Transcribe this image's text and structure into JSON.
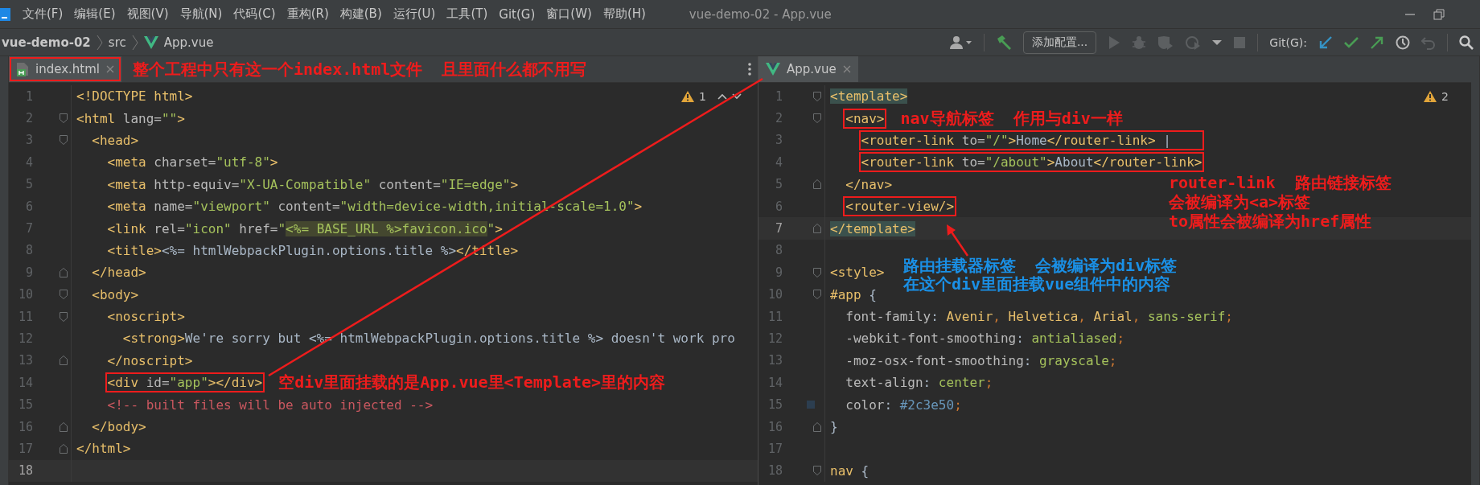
{
  "title_bar": {
    "menus": [
      "文件(F)",
      "编辑(E)",
      "视图(V)",
      "导航(N)",
      "代码(C)",
      "重构(R)",
      "构建(B)",
      "运行(U)",
      "工具(T)",
      "Git(G)",
      "窗口(W)",
      "帮助(H)"
    ],
    "title": "vue-demo-02 - App.vue"
  },
  "nav_bar": {
    "breadcrumbs": [
      {
        "text": "vue-demo-02",
        "kind": "project"
      },
      {
        "text": "src",
        "kind": "folder"
      },
      {
        "text": "App.vue",
        "kind": "vue"
      }
    ],
    "run_config": "添加配置...",
    "git_label": "Git(G):"
  },
  "panes": [
    {
      "tabs": [
        {
          "label": "index.html",
          "kind": "html",
          "selected": true,
          "boxed": true
        }
      ],
      "tab_note": {
        "text": "整个工程中只有这一个index.html文件  且里面什么都不用写",
        "color": "#ee1c1c"
      },
      "more_menu": true,
      "problems": "1",
      "nav_arrows": true,
      "lines": [
        {
          "n": "1",
          "current": false,
          "fold_start": false,
          "fold_end": false,
          "tokens": [
            {
              "kind": "tag",
              "text": "<!DOCTYPE html>"
            }
          ]
        },
        {
          "n": "2",
          "current": false,
          "fold_start": true,
          "fold_end": false,
          "tokens": [
            {
              "kind": "tag",
              "text": "<html"
            },
            {
              "kind": "attr",
              "text": " lang="
            },
            {
              "kind": "str",
              "text": "\"\""
            },
            {
              "kind": "tag",
              "text": ">"
            }
          ]
        },
        {
          "n": "3",
          "current": false,
          "fold_start": true,
          "fold_end": false,
          "tokens": [
            {
              "kind": "tag",
              "text": "  <head>"
            }
          ]
        },
        {
          "n": "4",
          "current": false,
          "fold_start": false,
          "fold_end": false,
          "tokens": [
            {
              "kind": "tag",
              "text": "    <meta"
            },
            {
              "kind": "attr",
              "text": " charset="
            },
            {
              "kind": "str",
              "text": "\"utf-8\""
            },
            {
              "kind": "tag",
              "text": ">"
            }
          ]
        },
        {
          "n": "5",
          "current": false,
          "fold_start": false,
          "fold_end": false,
          "tokens": [
            {
              "kind": "tag",
              "text": "    <meta"
            },
            {
              "kind": "attr",
              "text": " http-equiv="
            },
            {
              "kind": "str",
              "text": "\"X-UA-Compatible\""
            },
            {
              "kind": "attr",
              "text": " content="
            },
            {
              "kind": "str",
              "text": "\"IE=edge\""
            },
            {
              "kind": "tag",
              "text": ">"
            }
          ]
        },
        {
          "n": "6",
          "current": false,
          "fold_start": false,
          "fold_end": false,
          "tokens": [
            {
              "kind": "tag",
              "text": "    <meta"
            },
            {
              "kind": "attr",
              "text": " name="
            },
            {
              "kind": "str",
              "text": "\"viewport\""
            },
            {
              "kind": "attr",
              "text": " content="
            },
            {
              "kind": "str",
              "text": "\"width=device-width,initial-scale=1.0\""
            },
            {
              "kind": "tag",
              "text": ">"
            }
          ]
        },
        {
          "n": "7",
          "current": false,
          "fold_start": false,
          "fold_end": false,
          "tokens": [
            {
              "kind": "tag",
              "text": "    <link"
            },
            {
              "kind": "attr",
              "text": " rel="
            },
            {
              "kind": "str",
              "text": "\"icon\""
            },
            {
              "kind": "attr",
              "text": " href="
            },
            {
              "kind": "str",
              "text": "\""
            },
            {
              "kind": "inj",
              "text": "<%= BASE_URL %>favicon.ico"
            },
            {
              "kind": "str",
              "text": "\""
            },
            {
              "kind": "tag",
              "text": ">"
            }
          ]
        },
        {
          "n": "8",
          "current": false,
          "fold_start": false,
          "fold_end": false,
          "tokens": [
            {
              "kind": "tag",
              "text": "    <title>"
            },
            {
              "kind": "text",
              "text": "<%= htmlWebpackPlugin.options.title %>"
            },
            {
              "kind": "tag",
              "text": "</title>"
            }
          ]
        },
        {
          "n": "9",
          "current": false,
          "fold_start": false,
          "fold_end": true,
          "tokens": [
            {
              "kind": "tag",
              "text": "  </head>"
            }
          ]
        },
        {
          "n": "10",
          "current": false,
          "fold_start": true,
          "fold_end": false,
          "tokens": [
            {
              "kind": "tag",
              "text": "  <body>"
            }
          ]
        },
        {
          "n": "11",
          "current": false,
          "fold_start": true,
          "fold_end": false,
          "tokens": [
            {
              "kind": "tag",
              "text": "    <noscript>"
            }
          ]
        },
        {
          "n": "12",
          "current": false,
          "fold_start": false,
          "fold_end": false,
          "tokens": [
            {
              "kind": "tag",
              "text": "      <strong>"
            },
            {
              "kind": "text",
              "text": "We're sorry but <%= htmlWebpackPlugin.options.title %> doesn't work pro"
            }
          ]
        },
        {
          "n": "13",
          "current": false,
          "fold_start": false,
          "fold_end": true,
          "tokens": [
            {
              "kind": "tag",
              "text": "    </noscript>"
            }
          ]
        },
        {
          "n": "14",
          "current": false,
          "fold_start": false,
          "fold_end": false,
          "tokens": [
            {
              "kind": "box",
              "tokens": [
                {
                  "kind": "tag",
                  "text": "    <div"
                },
                {
                  "kind": "attr",
                  "text": " id="
                },
                {
                  "kind": "str",
                  "text": "\"app\""
                },
                {
                  "kind": "tag",
                  "text": "></div>"
                }
              ]
            }
          ],
          "note": {
            "text": "空div里面挂载的是App.vue里<Template>里的内容",
            "color": "#ee1c1c"
          }
        },
        {
          "n": "15",
          "current": false,
          "fold_start": false,
          "fold_end": false,
          "tokens": [
            {
              "kind": "comment",
              "text": "    <!-- built files will be auto injected -->"
            }
          ]
        },
        {
          "n": "16",
          "current": false,
          "fold_start": false,
          "fold_end": true,
          "tokens": [
            {
              "kind": "tag",
              "text": "  </body>"
            }
          ]
        },
        {
          "n": "17",
          "current": false,
          "fold_start": false,
          "fold_end": true,
          "tokens": [
            {
              "kind": "tag",
              "text": "</html>"
            }
          ]
        },
        {
          "n": "18",
          "current": true,
          "fold_start": false,
          "fold_end": false
        }
      ]
    },
    {
      "tabs": [
        {
          "label": "App.vue",
          "kind": "vue",
          "selected": true,
          "boxed": false
        }
      ],
      "more_menu": false,
      "problems": "2",
      "nav_arrows": false,
      "lines": [
        {
          "n": "1",
          "current": false,
          "fold_start": true,
          "fold_end": false,
          "tokens": [
            {
              "kind": "match",
              "text": "<template>"
            }
          ]
        },
        {
          "n": "2",
          "current": false,
          "fold_start": true,
          "fold_end": false,
          "tokens": [
            {
              "kind": "box",
              "tokens": [
                {
                  "kind": "tag",
                  "text": "  <nav>"
                }
              ]
            }
          ],
          "note": {
            "text": "nav导航标签  作用与div一样",
            "color": "#ee1c1c"
          }
        },
        {
          "n": "3",
          "current": false,
          "fold_start": false,
          "fold_end": false,
          "tokens": [
            {
              "kind": "box",
              "tokens": [
                {
                  "kind": "tag",
                  "text": "    <router-link"
                },
                {
                  "kind": "attr",
                  "text": " to="
                },
                {
                  "kind": "str",
                  "text": "\"/\""
                },
                {
                  "kind": "tag",
                  "text": ">"
                },
                {
                  "kind": "text",
                  "text": "Home"
                },
                {
                  "kind": "tag",
                  "text": "</router-link>"
                },
                {
                  "kind": "text",
                  "text": " |    "
                }
              ]
            }
          ]
        },
        {
          "n": "4",
          "current": false,
          "fold_start": false,
          "fold_end": false,
          "tokens": [
            {
              "kind": "box",
              "tokens": [
                {
                  "kind": "tag",
                  "text": "    <router-link"
                },
                {
                  "kind": "attr",
                  "text": " to="
                },
                {
                  "kind": "str",
                  "text": "\"/about\""
                },
                {
                  "kind": "tag",
                  "text": ">"
                },
                {
                  "kind": "text",
                  "text": "About"
                },
                {
                  "kind": "tag",
                  "text": "</router-link>"
                }
              ]
            }
          ]
        },
        {
          "n": "5",
          "current": false,
          "fold_start": false,
          "fold_end": true,
          "tokens": [
            {
              "kind": "tag",
              "text": "  </nav>"
            }
          ]
        },
        {
          "n": "6",
          "current": false,
          "fold_start": false,
          "fold_end": false,
          "tokens": [
            {
              "kind": "box",
              "tokens": [
                {
                  "kind": "tag",
                  "text": "  <router-view/>"
                }
              ]
            }
          ]
        },
        {
          "n": "7",
          "current": true,
          "fold_start": false,
          "fold_end": true,
          "tokens": [
            {
              "kind": "match",
              "text": "</template>"
            }
          ]
        },
        {
          "n": "8",
          "current": false,
          "fold_start": false,
          "fold_end": false
        },
        {
          "n": "9",
          "current": false,
          "fold_start": true,
          "fold_end": false,
          "tokens": [
            {
              "kind": "tag",
              "text": "<style>"
            }
          ]
        },
        {
          "n": "10",
          "current": false,
          "fold_start": true,
          "fold_end": false,
          "tokens": [
            {
              "kind": "sel",
              "text": "#app"
            },
            {
              "kind": "text",
              "text": " {"
            }
          ]
        },
        {
          "n": "11",
          "current": false,
          "fold_start": false,
          "fold_end": false,
          "tokens": [
            {
              "kind": "prop",
              "text": "  font-family"
            },
            {
              "kind": "text",
              "text": ": "
            },
            {
              "kind": "ident",
              "text": "Avenir"
            },
            {
              "kind": "punct",
              "text": ", "
            },
            {
              "kind": "ident",
              "text": "Helvetica"
            },
            {
              "kind": "punct",
              "text": ", "
            },
            {
              "kind": "ident",
              "text": "Arial"
            },
            {
              "kind": "punct",
              "text": ", "
            },
            {
              "kind": "val",
              "text": "sans-serif"
            },
            {
              "kind": "punct",
              "text": ";"
            }
          ]
        },
        {
          "n": "12",
          "current": false,
          "fold_start": false,
          "fold_end": false,
          "tokens": [
            {
              "kind": "prop",
              "text": "  -webkit-font-smoothing"
            },
            {
              "kind": "text",
              "text": ": "
            },
            {
              "kind": "val",
              "text": "antialiased"
            },
            {
              "kind": "punct",
              "text": ";"
            }
          ]
        },
        {
          "n": "13",
          "current": false,
          "fold_start": false,
          "fold_end": false,
          "tokens": [
            {
              "kind": "prop",
              "text": "  -moz-osx-font-smoothing"
            },
            {
              "kind": "text",
              "text": ": "
            },
            {
              "kind": "val",
              "text": "grayscale"
            },
            {
              "kind": "punct",
              "text": ";"
            }
          ]
        },
        {
          "n": "14",
          "current": false,
          "fold_start": false,
          "fold_end": false,
          "tokens": [
            {
              "kind": "prop",
              "text": "  text-align"
            },
            {
              "kind": "text",
              "text": ": "
            },
            {
              "kind": "val",
              "text": "center"
            },
            {
              "kind": "punct",
              "text": ";"
            }
          ]
        },
        {
          "n": "15",
          "current": false,
          "fold_start": false,
          "fold_end": false,
          "color": "#2c3e50",
          "tokens": [
            {
              "kind": "prop",
              "text": "  color"
            },
            {
              "kind": "text",
              "text": ": "
            },
            {
              "kind": "hex",
              "text": "#2c3e50"
            },
            {
              "kind": "punct",
              "text": ";"
            }
          ]
        },
        {
          "n": "16",
          "current": false,
          "fold_start": false,
          "fold_end": true,
          "tokens": [
            {
              "kind": "text",
              "text": "}"
            }
          ]
        },
        {
          "n": "17",
          "current": false,
          "fold_start": false,
          "fold_end": false
        },
        {
          "n": "18",
          "current": false,
          "fold_start": true,
          "fold_end": false,
          "tokens": [
            {
              "kind": "sel",
              "text": "nav"
            },
            {
              "kind": "text",
              "text": " {"
            }
          ]
        }
      ],
      "notes": [
        {
          "lines": [
            "router-link  路由链接标签",
            "会被编译为<a>标签",
            "to属性会被编译为href属性"
          ],
          "color": "#ee1c1c"
        },
        {
          "lines": [
            "路由挂载器标签  会被编译为div标签",
            "在这个div里面挂载vue组件中的内容"
          ],
          "color": "#1a90e6"
        }
      ]
    }
  ]
}
